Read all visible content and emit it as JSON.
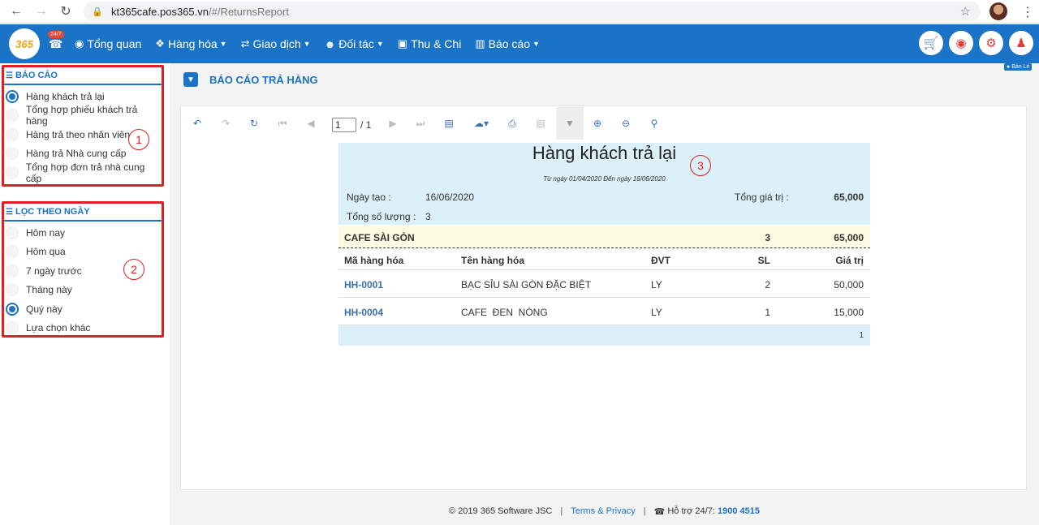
{
  "browser": {
    "url_host": "kt365cafe.pos365.vn",
    "url_path": "/#/ReturnsReport"
  },
  "nav": {
    "badge": "24/7",
    "logo_text": "365",
    "menu": [
      {
        "label": "Tổng quan",
        "icon": "dashboard-icon",
        "dropdown": false
      },
      {
        "label": "Hàng hóa",
        "icon": "cubes-icon",
        "dropdown": true
      },
      {
        "label": "Giao dịch",
        "icon": "exchange-icon",
        "dropdown": true
      },
      {
        "label": "Đối tác",
        "icon": "users-icon",
        "dropdown": true
      },
      {
        "label": "Thu & Chi",
        "icon": "money-icon",
        "dropdown": false
      },
      {
        "label": "Báo cáo",
        "icon": "chart-icon",
        "dropdown": true
      }
    ],
    "right_icons": [
      "cart-icon",
      "location-icon",
      "settings-icon",
      "user-icon"
    ],
    "store_badge": "Bán Lẻ"
  },
  "sidebar": {
    "report_panel": {
      "title": "BÁO CÁO",
      "items": [
        {
          "label": "Hàng khách trả lại",
          "selected": true
        },
        {
          "label": "Tổng hợp phiếu khách trả hàng",
          "selected": false
        },
        {
          "label": "Hàng trả theo nhân viên",
          "selected": false
        },
        {
          "label": "Hàng trả Nhà cung cấp",
          "selected": false
        },
        {
          "label": "Tổng hợp đơn trả nhà cung cấp",
          "selected": false
        }
      ],
      "annotation": "1"
    },
    "date_panel": {
      "title": "LỌC THEO NGÀY",
      "items": [
        {
          "label": "Hôm nay",
          "selected": false
        },
        {
          "label": "Hôm qua",
          "selected": false
        },
        {
          "label": "7 ngày trước",
          "selected": false
        },
        {
          "label": "Tháng này",
          "selected": false
        },
        {
          "label": "Quý này",
          "selected": true
        },
        {
          "label": "Lựa chọn khác",
          "selected": false
        }
      ],
      "annotation": "2"
    }
  },
  "main": {
    "title": "BÁO CÁO TRẢ HÀNG",
    "toolbar": {
      "page_current": "1",
      "page_total": "/ 1"
    },
    "report": {
      "title": "Hàng khách trả lại",
      "annotation": "3",
      "subtitle": "Từ ngày 01/04/2020 Đến ngày 16/06/2020",
      "created_label": "Ngày tạo :",
      "created_value": "16/06/2020",
      "qty_label": "Tổng số lượng :",
      "qty_value": "3",
      "total_label": "Tổng giá trị :",
      "total_value": "65,000",
      "group": {
        "name": "CAFE SÀI GÒN",
        "qty": "3",
        "value": "65,000"
      },
      "columns": [
        "Mã hàng hóa",
        "Tên hàng hóa",
        "ĐVT",
        "SL",
        "Giá trị"
      ],
      "rows": [
        {
          "code": "HH-0001",
          "name": "BẠC SỈU SÀI GÒN ĐẶC BIỆT",
          "unit": "LY",
          "qty": "2",
          "value": "50,000"
        },
        {
          "code": "HH-0004",
          "name": "CAFE  ĐEN  NÓNG",
          "unit": "LY",
          "qty": "1",
          "value": "15,000"
        }
      ],
      "page_number": "1"
    }
  },
  "footer": {
    "copyright": "© 2019 365 Software JSC",
    "terms": "Terms & Privacy",
    "support_label": "Hỗ trợ 24/7:",
    "support_phone": "1900 4515"
  },
  "colors": {
    "brand": "#1a73c6",
    "highlight": "#e02020",
    "report_header_bg": "#dcf0fa",
    "group_bg": "#fdfbe1"
  }
}
